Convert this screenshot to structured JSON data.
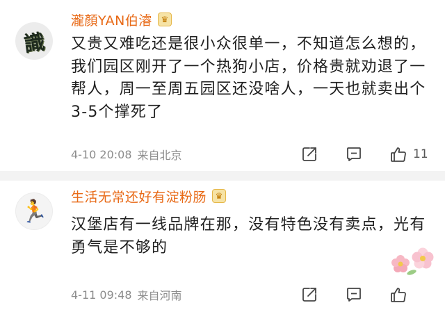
{
  "comments": [
    {
      "username": "瀧顏YAN伯濬",
      "badge": "♛",
      "avatar": "識",
      "text": "又贵又难吃还是很小众很单一，不知道怎么想的，我们园区刚开了一个热狗小店，价格贵就劝退了一帮人，周一至周五园区还没啥人，一天也就卖出个3-5个撑死了",
      "time": "4-10 20:08",
      "location": "来自北京",
      "likes": "11"
    },
    {
      "username": "生活无常还好有淀粉肠",
      "badge": "♛",
      "avatar": "🏃",
      "text": "汉堡店有一线品牌在那，没有特色没有卖点，光有勇气是不够的",
      "time": "4-11 09:48",
      "location": "来自河南",
      "likes": ""
    }
  ],
  "icons": {
    "share": "share-icon",
    "comment": "comment-icon",
    "like": "thumbs-up-icon",
    "sticker": "flower-sticker-icon"
  },
  "colors": {
    "username": "#e86a17",
    "meta": "#8c8c8c",
    "text": "#1f1f1f"
  }
}
